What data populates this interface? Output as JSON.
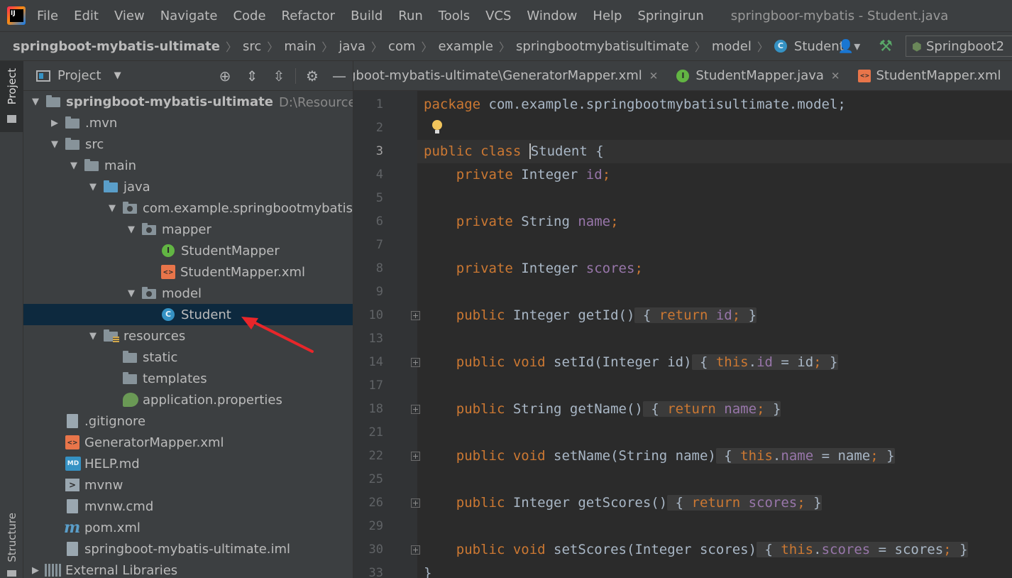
{
  "menubar": {
    "items": [
      "File",
      "Edit",
      "View",
      "Navigate",
      "Code",
      "Refactor",
      "Build",
      "Run",
      "Tools",
      "VCS",
      "Window",
      "Help",
      "Springirun"
    ],
    "window_title": "springboor-mybatis - Student.java"
  },
  "breadcrumb": {
    "items": [
      "springboot-mybatis-ultimate",
      "src",
      "main",
      "java",
      "com",
      "example",
      "springbootmybatisultimate",
      "model",
      "Student"
    ],
    "run_config": "Springboot2"
  },
  "toolstrip": {
    "project_label": "Project",
    "structure_label": "Structure"
  },
  "project_panel": {
    "title": "Project",
    "tree": [
      {
        "label": "springboot-mybatis-ultimate",
        "path": "D:\\Resource\\软",
        "bold": true
      },
      {
        "label": ".mvn"
      },
      {
        "label": "src"
      },
      {
        "label": "main"
      },
      {
        "label": "java"
      },
      {
        "label": "com.example.springbootmybatisu"
      },
      {
        "label": "mapper"
      },
      {
        "label": "StudentMapper"
      },
      {
        "label": "StudentMapper.xml"
      },
      {
        "label": "model"
      },
      {
        "label": "Student",
        "selected": true
      },
      {
        "label": "resources"
      },
      {
        "label": "static"
      },
      {
        "label": "templates"
      },
      {
        "label": "application.properties"
      },
      {
        "label": ".gitignore"
      },
      {
        "label": "GeneratorMapper.xml"
      },
      {
        "label": "HELP.md"
      },
      {
        "label": "mvnw"
      },
      {
        "label": "mvnw.cmd"
      },
      {
        "label": "pom.xml"
      },
      {
        "label": "springboot-mybatis-ultimate.iml"
      },
      {
        "label": "External Libraries"
      }
    ]
  },
  "editor": {
    "tabs": [
      {
        "label": "gboot-mybatis-ultimate\\GeneratorMapper.xml"
      },
      {
        "label": "StudentMapper.java"
      },
      {
        "label": "StudentMapper.xml"
      }
    ],
    "line_numbers": [
      "1",
      "2",
      "3",
      "4",
      "5",
      "6",
      "7",
      "8",
      "9",
      "10",
      "13",
      "14",
      "17",
      "18",
      "21",
      "22",
      "25",
      "26",
      "29",
      "30",
      "33"
    ],
    "code": {
      "l1_kw": "package",
      "l1_rest": " com.example.springbootmybatisultimate.model;",
      "l3_kw": "public class ",
      "l3_name": "Student",
      "l3_rest": " {",
      "l4_kw": "private",
      "l4_type": " Integer ",
      "l4_field": "id",
      "l6_kw": "private",
      "l6_type": " String ",
      "l6_field": "name",
      "l8_kw": "private",
      "l8_type": " Integer ",
      "l8_field": "scores",
      "l10_kw": "public",
      "l10_sig": " Integer getId()",
      "l10_ret": "return",
      "l10_field": "id",
      "l14_kw": "public void",
      "l14_sig": " setId(Integer id)",
      "l14_this": "this",
      "l14_field": "id",
      "l14_rest": " = id",
      "l18_kw": "public",
      "l18_sig": " String getName()",
      "l18_ret": "return",
      "l18_field": "name",
      "l22_kw": "public void",
      "l22_sig": " setName(String name)",
      "l22_this": "this",
      "l22_field": "name",
      "l22_rest": " = name",
      "l26_kw": "public",
      "l26_sig": " Integer getScores()",
      "l26_ret": "return",
      "l26_field": "scores",
      "l30_kw": "public void",
      "l30_sig": " setScores(Integer scores)",
      "l30_this": "this",
      "l30_field": "scores",
      "l30_rest": " = scores",
      "l33": "}"
    }
  }
}
